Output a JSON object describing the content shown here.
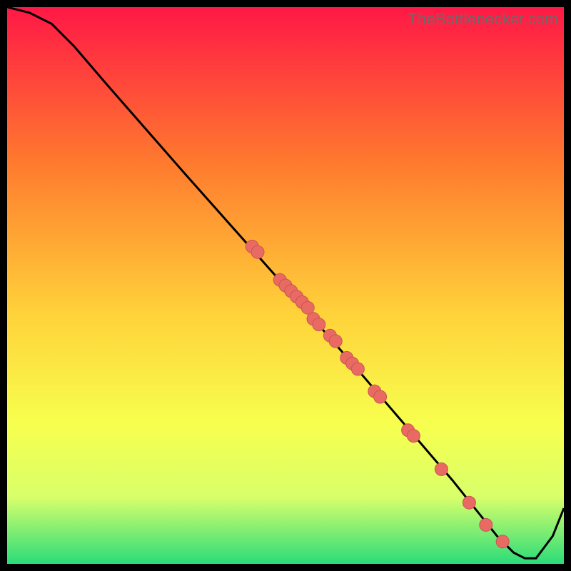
{
  "watermark": "TheBottlenecker.com",
  "colors": {
    "background": "#000000",
    "curve": "#000000",
    "curve_stroke": "#111111",
    "marker_fill": "#e86a63",
    "marker_stroke": "#c95650",
    "gradient_top": "#ff1846",
    "gradient_mid1": "#ff7a2e",
    "gradient_mid2": "#ffd23a",
    "gradient_mid3": "#f7ff4e",
    "gradient_mid4": "#d8ff6a",
    "gradient_bottom": "#2bdc7a"
  },
  "chart_data": {
    "type": "line",
    "title": "",
    "xlabel": "",
    "ylabel": "",
    "xlim": [
      0,
      100
    ],
    "ylim": [
      0,
      100
    ],
    "grid": false,
    "legend": false,
    "x": [
      0,
      4,
      8,
      12,
      18,
      25,
      32,
      40,
      48,
      55,
      62,
      68,
      74,
      80,
      84,
      88,
      91,
      93,
      95,
      98,
      100
    ],
    "values": [
      100,
      99,
      97,
      93,
      86,
      78,
      70,
      61,
      52,
      44,
      36,
      29,
      22,
      15,
      10,
      5,
      2,
      1,
      1,
      5,
      10
    ],
    "markers_x": [
      44,
      45,
      49,
      50,
      51,
      52,
      53,
      54,
      55,
      56,
      58,
      59,
      61,
      62,
      63,
      66,
      67,
      72,
      73,
      78,
      83,
      86,
      89
    ],
    "markers_y": [
      57,
      56,
      51,
      50,
      49,
      48,
      47,
      46,
      44,
      43,
      41,
      40,
      37,
      36,
      35,
      31,
      30,
      24,
      23,
      17,
      11,
      7,
      4
    ],
    "gradient_note": "vertical rainbow gradient red→orange→yellow→green representing bottleneck severity; curve is bottleneck % vs component strength; no axis ticks or labels shown"
  }
}
